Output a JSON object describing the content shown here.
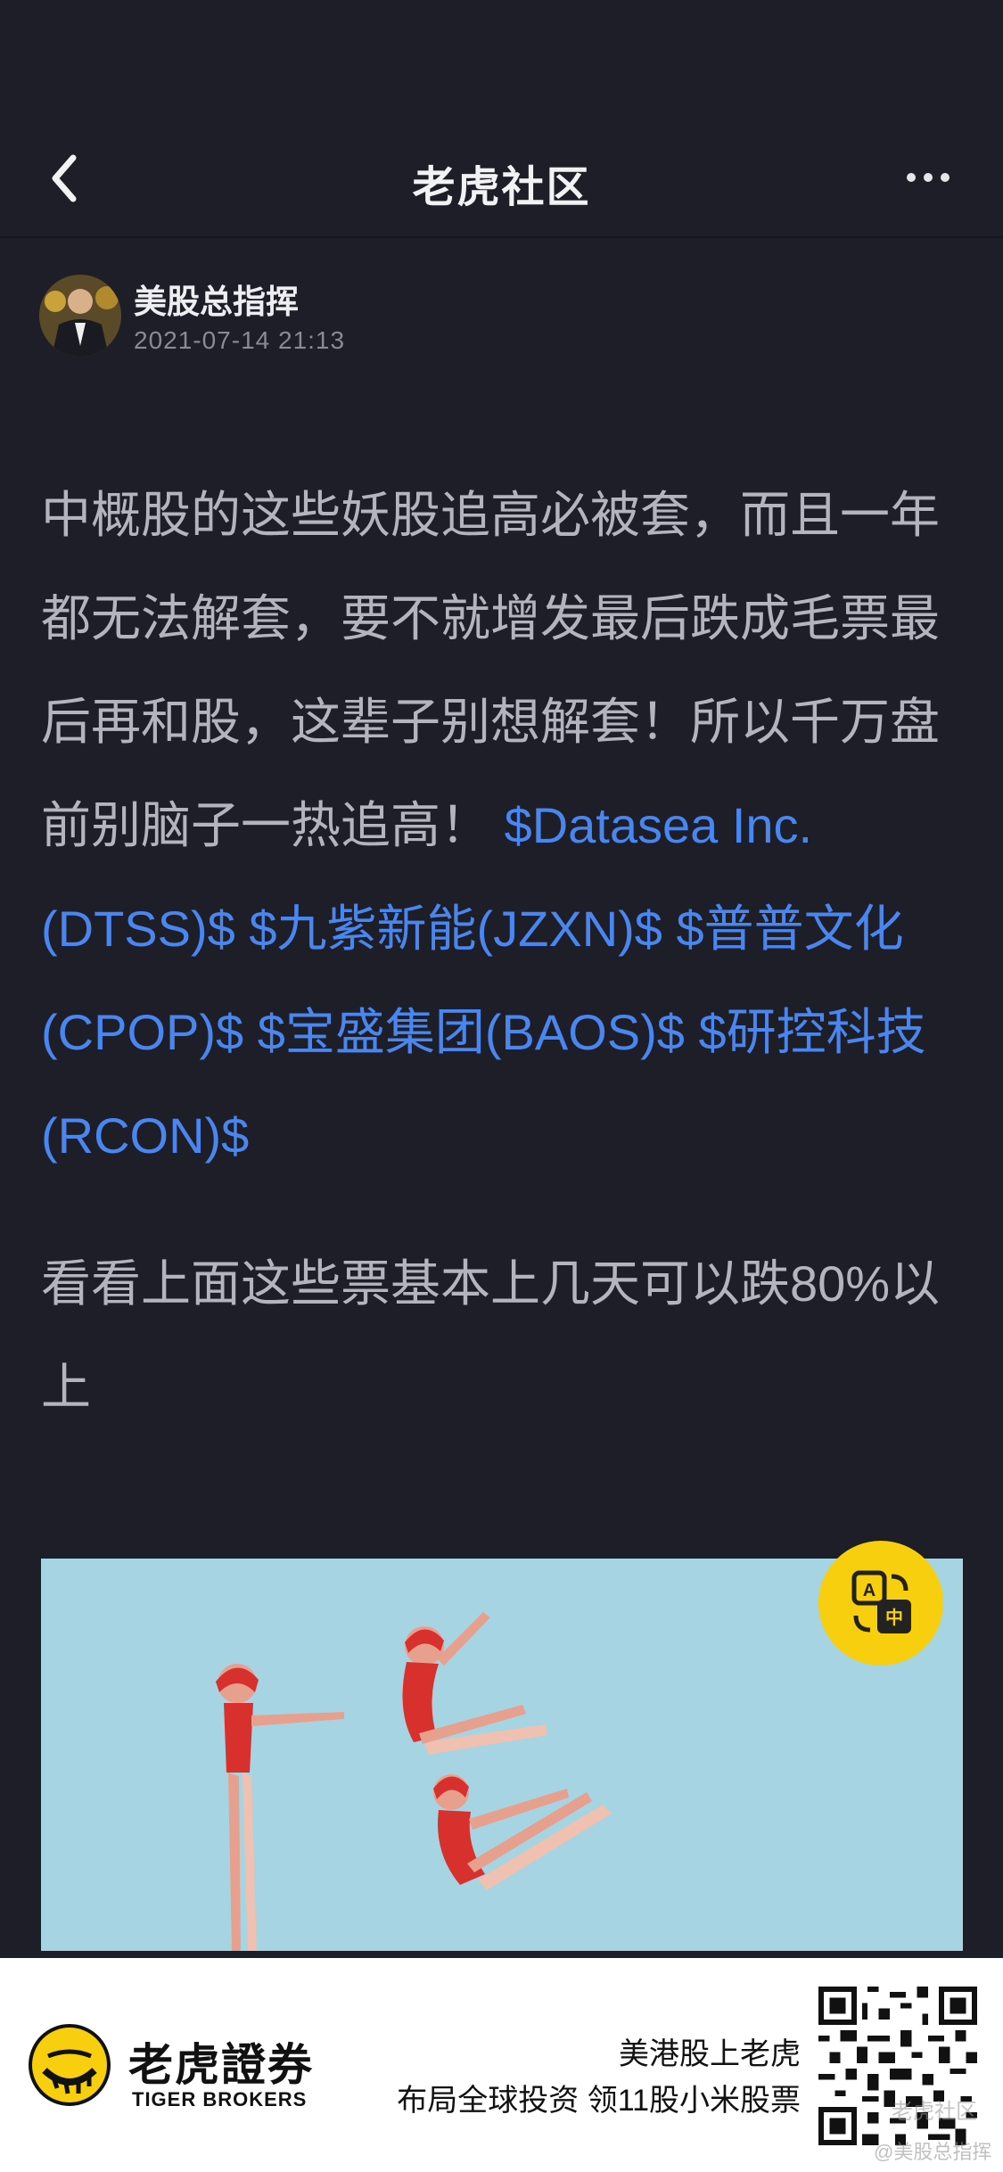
{
  "nav": {
    "title": "老虎社区",
    "back_icon": "chevron-left-icon",
    "more_icon": "more-horizontal-icon"
  },
  "post": {
    "author": "美股总指挥",
    "timestamp": "2021-07-14 21:13",
    "para1_text": "中概股的这些妖股追高必被套，而且一年都无法解套，要不就增发最后跌成毛票最后再和股，这辈子别想解套！所以千万盘前别脑子一热追高！",
    "tickers": [
      "$Datasea Inc.(DTSS)$",
      "$九紫新能(JZXN)$",
      "$普普文化(CPOP)$",
      "$宝盛集团(BAOS)$",
      "$研控科技(RCON)$"
    ],
    "para2_text": "看看上面这些票基本上几天可以跌80%以上",
    "image_icon": "divers-illustration",
    "translate_icon": "translate-icon"
  },
  "footer": {
    "brand_cn": "老虎證券",
    "brand_en": "TIGER BROKERS",
    "promo_line1": "美港股上老虎",
    "promo_line2": "布局全球投资 领11股小米股票",
    "qr_icon": "qr-code-icon",
    "watermark_brand": "老虎社区",
    "watermark_user": "@美股总指挥"
  },
  "colors": {
    "background": "#1e1e28",
    "body_text": "#b4b4c0",
    "ticker_link": "#4a86ef",
    "translate_button": "#f8cf0e"
  }
}
